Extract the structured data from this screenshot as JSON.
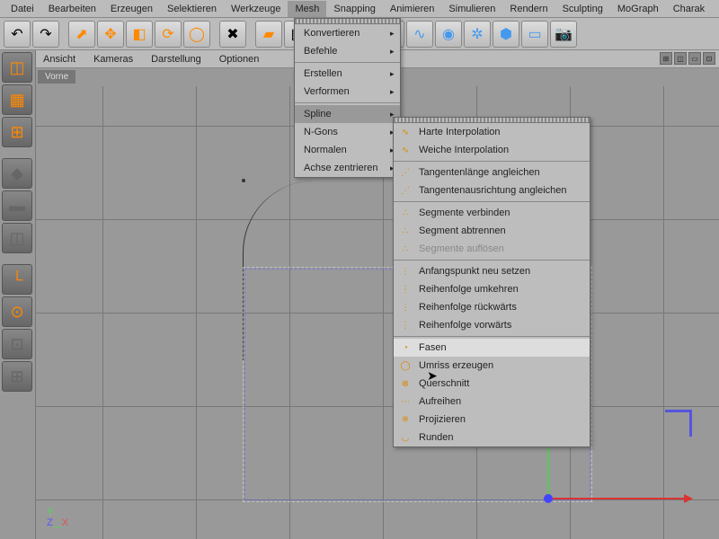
{
  "menubar": [
    "Datei",
    "Bearbeiten",
    "Erzeugen",
    "Selektieren",
    "Werkzeuge",
    "Mesh",
    "Snapping",
    "Animieren",
    "Simulieren",
    "Rendern",
    "Sculpting",
    "MoGraph",
    "Charak"
  ],
  "active_menu": 5,
  "vtabs": [
    "Ansicht",
    "Kameras",
    "Darstellung",
    "Optionen"
  ],
  "vtitle": "Vorne",
  "menu1": [
    {
      "label": "Konvertieren",
      "arrow": true
    },
    {
      "label": "Befehle",
      "arrow": true
    },
    {
      "sep": true
    },
    {
      "label": "Erstellen",
      "arrow": true
    },
    {
      "label": "Verformen",
      "arrow": true
    },
    {
      "sep": true
    },
    {
      "label": "Spline",
      "arrow": true,
      "active": true
    },
    {
      "label": "N-Gons",
      "arrow": true
    },
    {
      "label": "Normalen",
      "arrow": true
    },
    {
      "label": "Achse zentrieren",
      "arrow": true
    }
  ],
  "menu2": [
    {
      "label": "Harte Interpolation",
      "icon": "∿"
    },
    {
      "label": "Weiche Interpolation",
      "icon": "∿"
    },
    {
      "sep": true
    },
    {
      "label": "Tangentenlänge angleichen",
      "icon": "⋰"
    },
    {
      "label": "Tangentenausrichtung angleichen",
      "icon": "⋰"
    },
    {
      "sep": true
    },
    {
      "label": "Segmente verbinden",
      "icon": "∴"
    },
    {
      "label": "Segment abtrennen",
      "icon": "∴"
    },
    {
      "label": "Segmente auflösen",
      "icon": "∴",
      "disabled": true
    },
    {
      "sep": true
    },
    {
      "label": "Anfangspunkt neu setzen",
      "icon": "⋮"
    },
    {
      "label": "Reihenfolge umkehren",
      "icon": "⋮"
    },
    {
      "label": "Reihenfolge rückwärts",
      "icon": "⋮"
    },
    {
      "label": "Reihenfolge vorwärts",
      "icon": "⋮"
    },
    {
      "sep": true
    },
    {
      "label": "Fasen",
      "icon": "◔",
      "hover": true
    },
    {
      "label": "Umriss erzeugen",
      "icon": "◯"
    },
    {
      "label": "Querschnitt",
      "icon": "⊗"
    },
    {
      "label": "Aufreihen",
      "icon": "⋯"
    },
    {
      "label": "Projizieren",
      "icon": "※"
    },
    {
      "label": "Runden",
      "icon": "◡"
    }
  ],
  "gizmo": {
    "y": "Y",
    "z": "Z",
    "x": "X"
  }
}
